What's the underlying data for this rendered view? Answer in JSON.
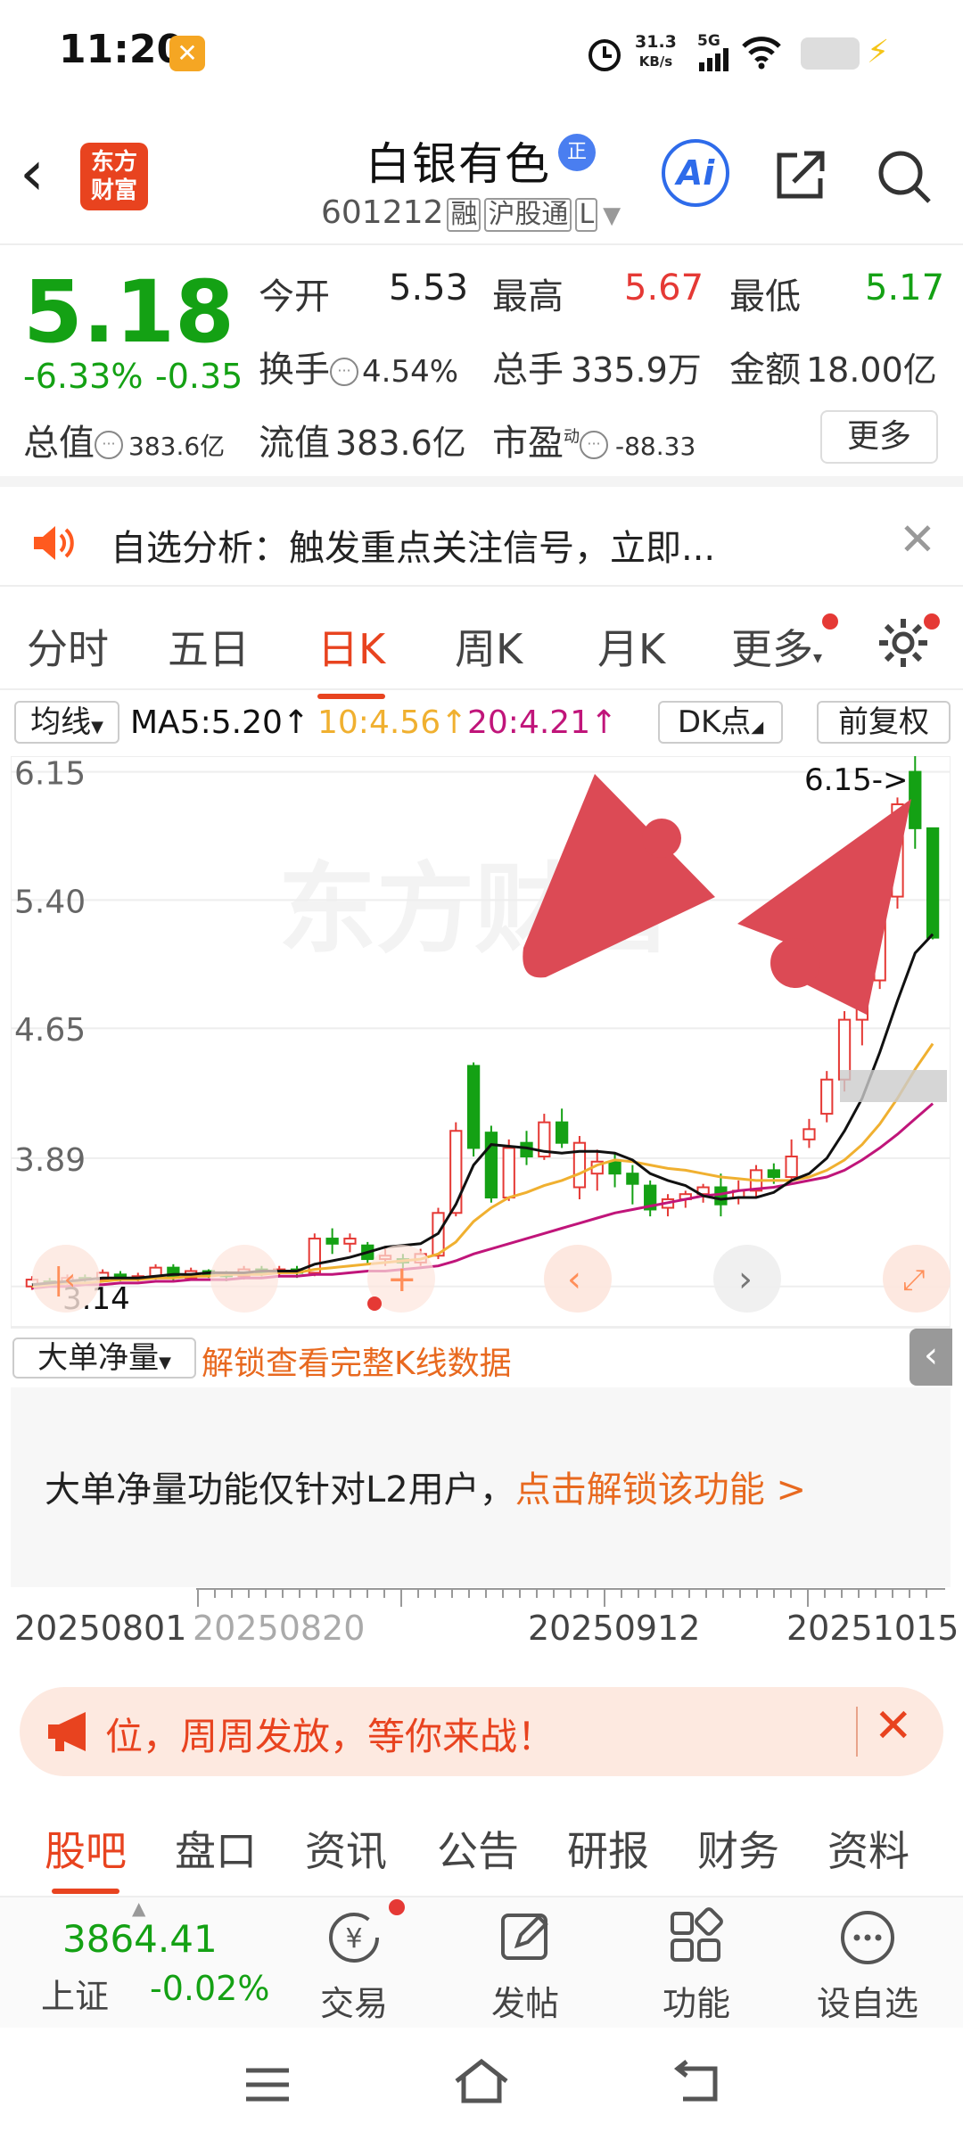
{
  "status_bar": {
    "time": "11:20",
    "net_speed": "31.3",
    "net_unit": "KB/s",
    "signal": "5G"
  },
  "header": {
    "stock_name": "白银有色",
    "badge": "正",
    "code": "601212",
    "tags": [
      "融",
      "沪股通",
      "L"
    ],
    "ai_label": "Ai"
  },
  "quote": {
    "price": "5.18",
    "change_pct": "-6.33%",
    "change": "-0.35",
    "open_label": "今开",
    "open": "5.53",
    "high_label": "最高",
    "high": "5.67",
    "low_label": "最低",
    "low": "5.17",
    "turnover_label": "换手",
    "turnover": "4.54%",
    "volume_label": "总手",
    "volume": "335.9万",
    "amount_label": "金额",
    "amount": "18.00亿",
    "mcap_label": "总值",
    "mcap": "383.6亿",
    "float_label": "流值",
    "float": "383.6亿",
    "pe_label": "市盈",
    "pe_sup": "动",
    "pe": "-88.33",
    "more_label": "更多"
  },
  "notice": {
    "text": "自选分析：触发重点关注信号，立即..."
  },
  "k_tabs": [
    "分时",
    "五日",
    "日K",
    "周K",
    "月K",
    "更多"
  ],
  "ma_bar": {
    "select": "均线",
    "ma5": "MA5:5.20↑",
    "ma10": "10:4.56↑",
    "ma20": "20:4.21↑",
    "dk": "DK点",
    "fq": "前复权",
    "colors": {
      "ma5": "#111111",
      "ma10": "#f0b030",
      "ma20": "#c0157a"
    }
  },
  "chart_data": {
    "type": "candlestick",
    "y_ticks": [
      "6.15",
      "5.40",
      "4.65",
      "3.89",
      "3.14"
    ],
    "ylim": [
      3.05,
      6.2
    ],
    "max_label": "6.15->",
    "min_label": "3.14",
    "watermark": "东方财富",
    "x_ticks": [
      "20250801",
      "20250820",
      "20250912",
      "20251015"
    ],
    "up_color": "#e53935",
    "down_color": "#14a114",
    "candles": [
      [
        3.14,
        3.18,
        3.12,
        3.2
      ],
      [
        3.17,
        3.16,
        3.14,
        3.19
      ],
      [
        3.16,
        3.19,
        3.15,
        3.21
      ],
      [
        3.19,
        3.18,
        3.16,
        3.21
      ],
      [
        3.18,
        3.22,
        3.17,
        3.24
      ],
      [
        3.21,
        3.19,
        3.17,
        3.23
      ],
      [
        3.19,
        3.2,
        3.17,
        3.22
      ],
      [
        3.2,
        3.25,
        3.18,
        3.27
      ],
      [
        3.25,
        3.19,
        3.17,
        3.27
      ],
      [
        3.19,
        3.23,
        3.18,
        3.25
      ],
      [
        3.23,
        3.21,
        3.19,
        3.24
      ],
      [
        3.21,
        3.2,
        3.17,
        3.23
      ],
      [
        3.2,
        3.24,
        3.18,
        3.26
      ],
      [
        3.24,
        3.22,
        3.2,
        3.26
      ],
      [
        3.22,
        3.24,
        3.2,
        3.26
      ],
      [
        3.24,
        3.22,
        3.19,
        3.26
      ],
      [
        3.22,
        3.42,
        3.2,
        3.45
      ],
      [
        3.42,
        3.39,
        3.33,
        3.48
      ],
      [
        3.39,
        3.42,
        3.34,
        3.45
      ],
      [
        3.38,
        3.3,
        3.27,
        3.4
      ],
      [
        3.3,
        3.32,
        3.26,
        3.36
      ],
      [
        3.3,
        3.28,
        3.24,
        3.33
      ],
      [
        3.28,
        3.33,
        3.26,
        3.36
      ],
      [
        3.32,
        3.57,
        3.3,
        3.6
      ],
      [
        3.57,
        4.05,
        3.55,
        4.1
      ],
      [
        4.43,
        3.95,
        3.9,
        4.45
      ],
      [
        4.04,
        3.66,
        3.63,
        4.08
      ],
      [
        3.66,
        3.95,
        3.64,
        4.0
      ],
      [
        3.98,
        3.9,
        3.85,
        4.05
      ],
      [
        3.9,
        4.1,
        3.88,
        4.15
      ],
      [
        4.1,
        3.98,
        3.95,
        4.18
      ],
      [
        3.72,
        3.98,
        3.65,
        4.02
      ],
      [
        3.8,
        3.87,
        3.7,
        3.94
      ],
      [
        3.87,
        3.8,
        3.72,
        3.92
      ],
      [
        3.8,
        3.74,
        3.62,
        3.85
      ],
      [
        3.73,
        3.59,
        3.55,
        3.76
      ],
      [
        3.6,
        3.65,
        3.55,
        3.68
      ],
      [
        3.65,
        3.68,
        3.6,
        3.7
      ],
      [
        3.68,
        3.72,
        3.63,
        3.74
      ],
      [
        3.72,
        3.62,
        3.55,
        3.8
      ],
      [
        3.66,
        3.7,
        3.62,
        3.76
      ],
      [
        3.7,
        3.82,
        3.66,
        3.85
      ],
      [
        3.82,
        3.78,
        3.74,
        3.86
      ],
      [
        3.78,
        3.9,
        3.75,
        4.0
      ],
      [
        4.0,
        4.06,
        3.95,
        4.12
      ],
      [
        4.15,
        4.35,
        4.1,
        4.4
      ],
      [
        4.35,
        4.7,
        4.28,
        4.75
      ],
      [
        4.7,
        4.93,
        4.55,
        4.98
      ],
      [
        4.93,
        5.42,
        4.88,
        5.55
      ],
      [
        5.42,
        5.96,
        5.35,
        6.0
      ],
      [
        6.15,
        5.82,
        5.7,
        6.25
      ],
      [
        5.82,
        5.18,
        5.17,
        5.67
      ]
    ],
    "ma5": [
      3.15,
      3.16,
      3.17,
      3.18,
      3.19,
      3.19,
      3.19,
      3.2,
      3.21,
      3.21,
      3.22,
      3.22,
      3.22,
      3.23,
      3.23,
      3.23,
      3.27,
      3.29,
      3.31,
      3.34,
      3.37,
      3.38,
      3.39,
      3.45,
      3.62,
      3.85,
      3.97,
      3.96,
      3.95,
      3.93,
      3.92,
      3.93,
      3.93,
      3.92,
      3.88,
      3.8,
      3.76,
      3.73,
      3.67,
      3.65,
      3.66,
      3.66,
      3.69,
      3.76,
      3.8,
      3.89,
      4.05,
      4.24,
      4.51,
      4.81,
      5.09,
      5.2
    ],
    "ma10": [
      3.14,
      3.15,
      3.16,
      3.16,
      3.17,
      3.18,
      3.18,
      3.19,
      3.19,
      3.2,
      3.2,
      3.21,
      3.21,
      3.21,
      3.22,
      3.22,
      3.24,
      3.25,
      3.26,
      3.27,
      3.28,
      3.29,
      3.3,
      3.33,
      3.4,
      3.52,
      3.6,
      3.66,
      3.69,
      3.73,
      3.76,
      3.8,
      3.85,
      3.88,
      3.87,
      3.85,
      3.83,
      3.82,
      3.8,
      3.78,
      3.77,
      3.76,
      3.76,
      3.76,
      3.78,
      3.82,
      3.88,
      3.97,
      4.09,
      4.24,
      4.41,
      4.56
    ],
    "ma20": [
      3.13,
      3.14,
      3.14,
      3.15,
      3.15,
      3.16,
      3.16,
      3.17,
      3.17,
      3.18,
      3.18,
      3.18,
      3.19,
      3.19,
      3.2,
      3.2,
      3.21,
      3.21,
      3.22,
      3.23,
      3.23,
      3.24,
      3.25,
      3.26,
      3.29,
      3.33,
      3.36,
      3.39,
      3.42,
      3.45,
      3.48,
      3.51,
      3.54,
      3.57,
      3.59,
      3.61,
      3.63,
      3.65,
      3.67,
      3.68,
      3.7,
      3.71,
      3.72,
      3.74,
      3.76,
      3.78,
      3.82,
      3.88,
      3.95,
      4.03,
      4.12,
      4.21
    ]
  },
  "dadan": {
    "select": "大单净量",
    "unlock_link": "解锁查看完整K线数据",
    "message": "大单净量功能仅针对L2用户，",
    "message_link": "点击解锁该功能 >"
  },
  "promo": {
    "text": "位，周周发放，等你来战！"
  },
  "f_tabs": [
    "股吧",
    "盘口",
    "资讯",
    "公告",
    "研报",
    "财务",
    "资料"
  ],
  "bottom": {
    "index_value": "3864.41",
    "index_name": "上证",
    "index_change": "-0.02%",
    "items": [
      "交易",
      "发帖",
      "功能",
      "设自选"
    ]
  }
}
